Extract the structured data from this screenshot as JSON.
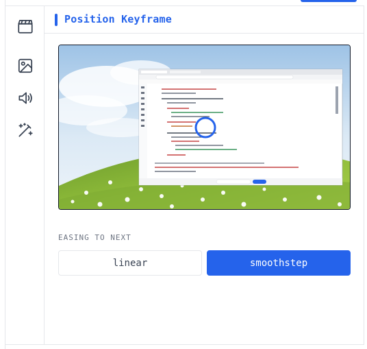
{
  "panel": {
    "title": "Position Keyframe",
    "accent_color": "#2563eb"
  },
  "rail": {
    "items": [
      {
        "icon": "clapperboard-icon"
      },
      {
        "icon": "image-icon"
      },
      {
        "icon": "speaker-icon"
      },
      {
        "icon": "magic-wand-icon"
      }
    ]
  },
  "preview": {
    "description_icon": "keyframe-position-marker"
  },
  "easing": {
    "label": "EASING TO NEXT",
    "options": [
      "linear",
      "smoothstep"
    ],
    "selected": "smoothstep"
  },
  "colors": {
    "accent": "#2563eb",
    "border": "#e5e7eb",
    "muted_text": "#6b7280"
  }
}
